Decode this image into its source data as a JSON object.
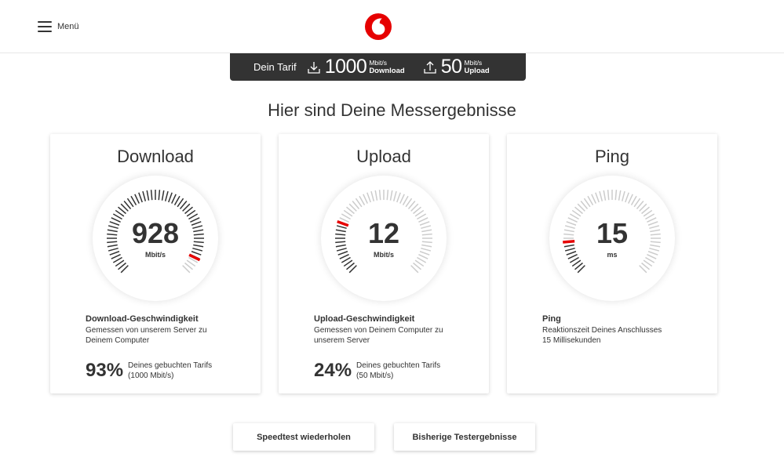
{
  "header": {
    "menu_label": "Menü",
    "logo_icon": "vodafone-logo-icon",
    "brand_color": "#e60000"
  },
  "tariff": {
    "label": "Dein Tarif",
    "download": {
      "value": "1000",
      "unit": "Mbit/s",
      "kind": "Download",
      "icon": "download-icon"
    },
    "upload": {
      "value": "50",
      "unit": "Mbit/s",
      "kind": "Upload",
      "icon": "upload-icon"
    }
  },
  "headline": "Hier sind Deine Messergebnisse",
  "cards": [
    {
      "title": "Download",
      "value": "928",
      "unit": "Mbit/s",
      "gauge_level": 0.93,
      "info_title": "Download-Geschwindigkeit",
      "info_desc_1": "Gemessen von unserem Server zu",
      "info_desc_2": "Deinem Computer",
      "percent": "93%",
      "percent_text_1": "Deines gebuchten Tarifs",
      "percent_text_2": "(1000 Mbit/s)"
    },
    {
      "title": "Upload",
      "value": "12",
      "unit": "Mbit/s",
      "gauge_level": 0.24,
      "info_title": "Upload-Geschwindigkeit",
      "info_desc_1": "Gemessen von Deinem Computer zu",
      "info_desc_2": "unserem Server",
      "percent": "24%",
      "percent_text_1": "Deines gebuchten Tarifs",
      "percent_text_2": "(50 Mbit/s)"
    },
    {
      "title": "Ping",
      "value": "15",
      "unit": "ms",
      "gauge_level": 0.15,
      "info_title": "Ping",
      "info_desc_1": "Reaktionszeit Deines Anschlusses",
      "info_desc_2": "15 Millisekunden"
    }
  ],
  "buttons": {
    "repeat": "Speedtest wiederholen",
    "history": "Bisherige Testergebnisse"
  },
  "colors": {
    "tick_active": "#333333",
    "tick_inactive": "#cccccc",
    "needle": "#e60000",
    "tariff_bar": "#333333"
  }
}
